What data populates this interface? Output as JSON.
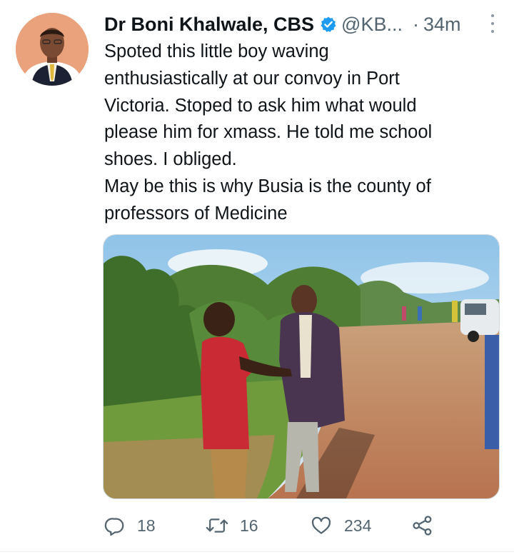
{
  "tweet": {
    "author_name": "Dr Boni Khalwale, CBS",
    "handle": "@KB...",
    "separator": "·",
    "time": "34m",
    "text_lines": [
      "Spoted this little boy waving",
      "enthusiastically at our convoy in Port",
      "Victoria. Stoped to ask him what would",
      "please him for xmass. He told me school",
      "shoes. I obliged.",
      "May be this is why Busia is the county of",
      "professors of Medicine"
    ]
  },
  "actions": {
    "reply_count": "18",
    "retweet_count": "16",
    "like_count": "234"
  },
  "icons": {
    "verified": "verified-badge-icon",
    "more": "more-options-icon",
    "reply": "reply-icon",
    "retweet": "retweet-icon",
    "like": "heart-icon",
    "share": "share-icon"
  },
  "colors": {
    "verified_blue": "#1d9bf0",
    "secondary_text": "#536471",
    "primary_text": "#0f1419"
  }
}
